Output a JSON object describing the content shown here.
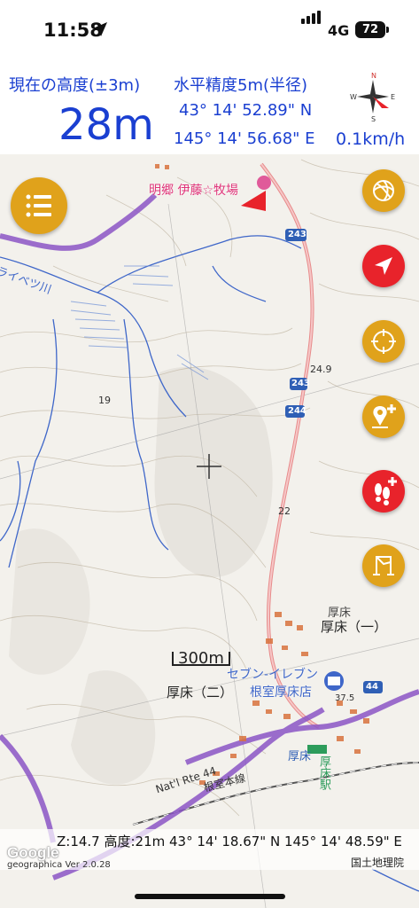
{
  "status_bar": {
    "time": "11:58",
    "network": "4G",
    "battery": "72"
  },
  "info_panel": {
    "altitude_label": "現在の高度(±3m)",
    "altitude_value": "28m",
    "accuracy_label": "水平精度5m(半径)",
    "latitude": "43° 14' 52.89\" N",
    "longitude": "145° 14' 56.68\" E",
    "speed": "0.1km/h",
    "compass_labels": {
      "n": "N",
      "s": "S",
      "e": "E",
      "w": "W"
    }
  },
  "map": {
    "place_labels": {
      "farm": "明郷 伊藤☆牧場",
      "river": "ライベツ川",
      "route_243a": "243",
      "route_243b": "243",
      "route_244": "244",
      "route_44": "44",
      "elev_249": "24.9",
      "elev_22": "22",
      "elev_19": "19",
      "akkeshi_1_small": "厚床",
      "akkeshi_1": "厚床（一）",
      "akkeshi_2": "厚床（二）",
      "seven_eleven": "セブン-イレブン",
      "seven_eleven_branch": "根室厚床店",
      "akkeshi_en": "厚床",
      "akkeshi_station": "厚床駅",
      "nat_rte": "Nat'l Rte 44",
      "nemuro_line": "根室本線",
      "elev_375": "37.5"
    },
    "scale": "300m",
    "bottom_info": "Z:14.7 高度:21m  43° 14' 18.67\" N 145° 14' 48.59\" E",
    "attribution": "国土地理院",
    "google": "Google",
    "version": "geographica Ver 2.0.28"
  },
  "colors": {
    "accent": "#1a3fd1",
    "fab_orange": "#e0a21b",
    "fab_red": "#e8232b",
    "purple_route": "#8b55c6",
    "river": "#3f67c9"
  },
  "icons": {
    "menu": "list-icon",
    "layers": "swirl-icon",
    "location": "navigation-arrow-icon",
    "center": "crosshair-target-icon",
    "add_pin": "add-pin-icon",
    "add_footprint": "add-footprint-icon",
    "route": "route-flag-icon"
  }
}
